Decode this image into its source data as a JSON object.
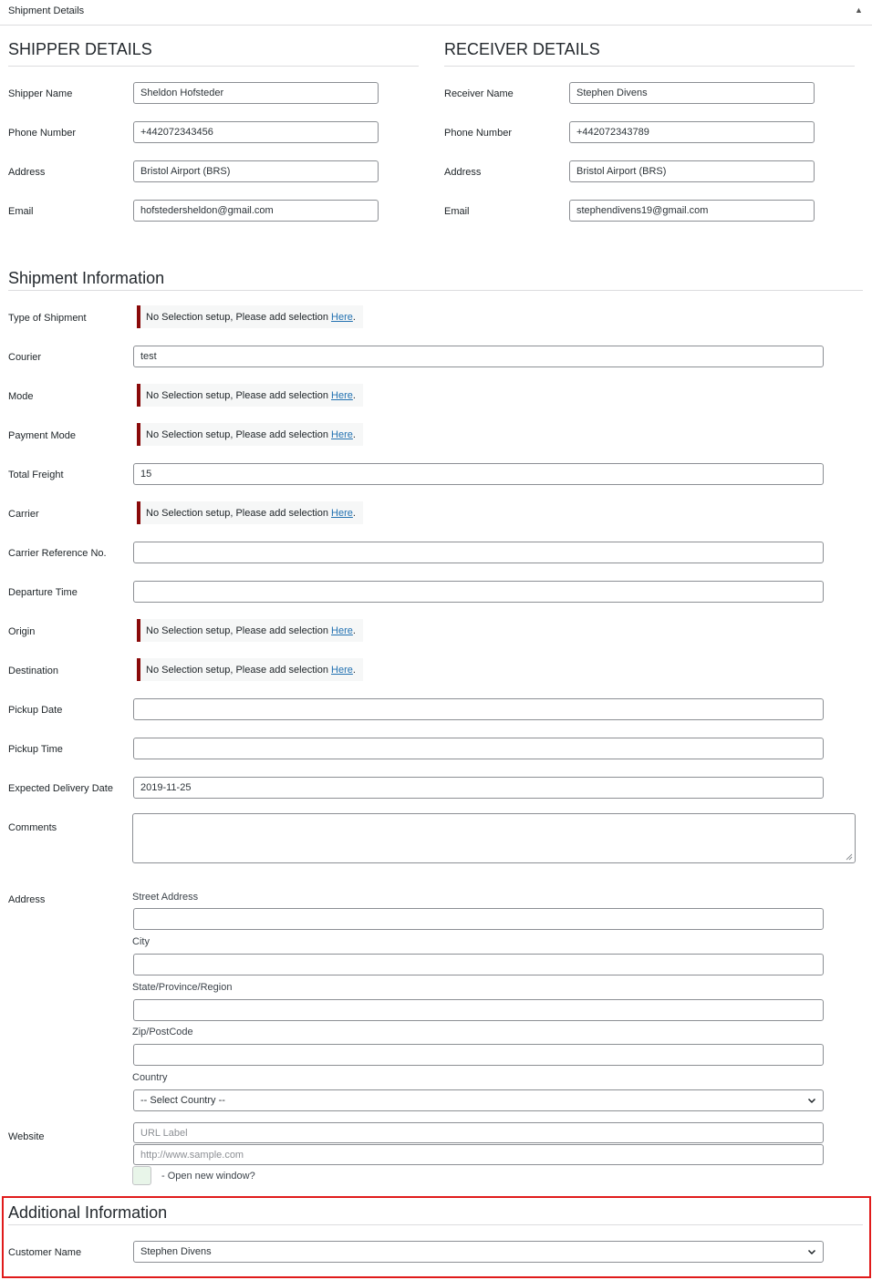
{
  "panel": {
    "title": "Shipment Details",
    "collapse_glyph": "▲"
  },
  "shipper": {
    "heading": "SHIPPER DETAILS",
    "fields": [
      {
        "label": "Shipper Name",
        "value": "Sheldon Hofsteder"
      },
      {
        "label": "Phone Number",
        "value": "+442072343456"
      },
      {
        "label": "Address",
        "value": "Bristol Airport (BRS)"
      },
      {
        "label": "Email",
        "value": "hofstedersheldon@gmail.com"
      }
    ]
  },
  "receiver": {
    "heading": "RECEIVER DETAILS",
    "fields": [
      {
        "label": "Receiver Name",
        "value": "Stephen Divens"
      },
      {
        "label": "Phone Number",
        "value": "+442072343789"
      },
      {
        "label": "Address",
        "value": "Bristol Airport (BRS)"
      },
      {
        "label": "Email",
        "value": "stephendivens19@gmail.com"
      }
    ]
  },
  "shipment": {
    "heading": "Shipment Information",
    "notice": {
      "text": "No Selection setup, Please add selection ",
      "link": "Here",
      "period": "."
    },
    "fields": {
      "type_of_shipment": {
        "label": "Type of Shipment"
      },
      "courier": {
        "label": "Courier",
        "value": "test"
      },
      "mode": {
        "label": "Mode"
      },
      "payment_mode": {
        "label": "Payment Mode"
      },
      "total_freight": {
        "label": "Total Freight",
        "value": "15"
      },
      "carrier": {
        "label": "Carrier"
      },
      "carrier_ref": {
        "label": "Carrier Reference No.",
        "value": ""
      },
      "departure_time": {
        "label": "Departure Time",
        "value": ""
      },
      "origin": {
        "label": "Origin"
      },
      "destination": {
        "label": "Destination"
      },
      "pickup_date": {
        "label": "Pickup Date",
        "value": ""
      },
      "pickup_time": {
        "label": "Pickup Time",
        "value": ""
      },
      "expected_delivery": {
        "label": "Expected Delivery Date",
        "value": "2019-11-25"
      },
      "comments": {
        "label": "Comments",
        "value": ""
      }
    },
    "address": {
      "label": "Address",
      "street": {
        "label": "Street Address",
        "value": ""
      },
      "city": {
        "label": "City",
        "value": ""
      },
      "state": {
        "label": "State/Province/Region",
        "value": ""
      },
      "zip": {
        "label": "Zip/PostCode",
        "value": ""
      },
      "country": {
        "label": "Country",
        "selected": "-- Select Country --"
      }
    },
    "website": {
      "label": "Website",
      "url_label_placeholder": "URL Label",
      "url_placeholder": "http://www.sample.com",
      "open_new_window_label": "- Open new window?"
    }
  },
  "additional": {
    "heading": "Additional Information",
    "customer_name": {
      "label": "Customer Name",
      "selected": "Stephen Divens"
    }
  },
  "colors": {
    "notice_border": "#8a0a0a",
    "link": "#2271b1",
    "highlight_box": "#e01b1b"
  }
}
